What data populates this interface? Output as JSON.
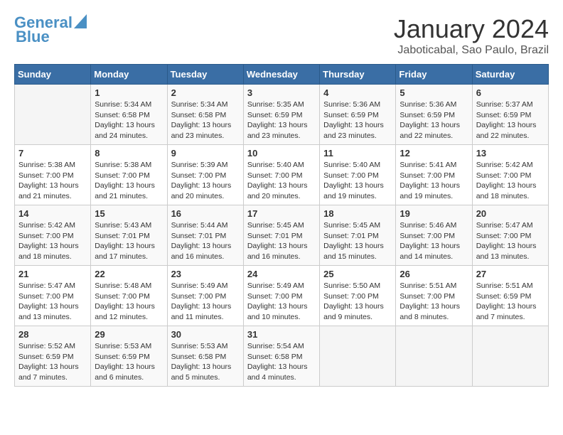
{
  "header": {
    "logo_line1": "General",
    "logo_line2": "Blue",
    "title": "January 2024",
    "subtitle": "Jaboticabal, Sao Paulo, Brazil"
  },
  "days_of_week": [
    "Sunday",
    "Monday",
    "Tuesday",
    "Wednesday",
    "Thursday",
    "Friday",
    "Saturday"
  ],
  "weeks": [
    [
      {
        "day": "",
        "content": ""
      },
      {
        "day": "1",
        "content": "Sunrise: 5:34 AM\nSunset: 6:58 PM\nDaylight: 13 hours\nand 24 minutes."
      },
      {
        "day": "2",
        "content": "Sunrise: 5:34 AM\nSunset: 6:58 PM\nDaylight: 13 hours\nand 23 minutes."
      },
      {
        "day": "3",
        "content": "Sunrise: 5:35 AM\nSunset: 6:59 PM\nDaylight: 13 hours\nand 23 minutes."
      },
      {
        "day": "4",
        "content": "Sunrise: 5:36 AM\nSunset: 6:59 PM\nDaylight: 13 hours\nand 23 minutes."
      },
      {
        "day": "5",
        "content": "Sunrise: 5:36 AM\nSunset: 6:59 PM\nDaylight: 13 hours\nand 22 minutes."
      },
      {
        "day": "6",
        "content": "Sunrise: 5:37 AM\nSunset: 6:59 PM\nDaylight: 13 hours\nand 22 minutes."
      }
    ],
    [
      {
        "day": "7",
        "content": "Sunrise: 5:38 AM\nSunset: 7:00 PM\nDaylight: 13 hours\nand 21 minutes."
      },
      {
        "day": "8",
        "content": "Sunrise: 5:38 AM\nSunset: 7:00 PM\nDaylight: 13 hours\nand 21 minutes."
      },
      {
        "day": "9",
        "content": "Sunrise: 5:39 AM\nSunset: 7:00 PM\nDaylight: 13 hours\nand 20 minutes."
      },
      {
        "day": "10",
        "content": "Sunrise: 5:40 AM\nSunset: 7:00 PM\nDaylight: 13 hours\nand 20 minutes."
      },
      {
        "day": "11",
        "content": "Sunrise: 5:40 AM\nSunset: 7:00 PM\nDaylight: 13 hours\nand 19 minutes."
      },
      {
        "day": "12",
        "content": "Sunrise: 5:41 AM\nSunset: 7:00 PM\nDaylight: 13 hours\nand 19 minutes."
      },
      {
        "day": "13",
        "content": "Sunrise: 5:42 AM\nSunset: 7:00 PM\nDaylight: 13 hours\nand 18 minutes."
      }
    ],
    [
      {
        "day": "14",
        "content": "Sunrise: 5:42 AM\nSunset: 7:00 PM\nDaylight: 13 hours\nand 18 minutes."
      },
      {
        "day": "15",
        "content": "Sunrise: 5:43 AM\nSunset: 7:01 PM\nDaylight: 13 hours\nand 17 minutes."
      },
      {
        "day": "16",
        "content": "Sunrise: 5:44 AM\nSunset: 7:01 PM\nDaylight: 13 hours\nand 16 minutes."
      },
      {
        "day": "17",
        "content": "Sunrise: 5:45 AM\nSunset: 7:01 PM\nDaylight: 13 hours\nand 16 minutes."
      },
      {
        "day": "18",
        "content": "Sunrise: 5:45 AM\nSunset: 7:01 PM\nDaylight: 13 hours\nand 15 minutes."
      },
      {
        "day": "19",
        "content": "Sunrise: 5:46 AM\nSunset: 7:00 PM\nDaylight: 13 hours\nand 14 minutes."
      },
      {
        "day": "20",
        "content": "Sunrise: 5:47 AM\nSunset: 7:00 PM\nDaylight: 13 hours\nand 13 minutes."
      }
    ],
    [
      {
        "day": "21",
        "content": "Sunrise: 5:47 AM\nSunset: 7:00 PM\nDaylight: 13 hours\nand 13 minutes."
      },
      {
        "day": "22",
        "content": "Sunrise: 5:48 AM\nSunset: 7:00 PM\nDaylight: 13 hours\nand 12 minutes."
      },
      {
        "day": "23",
        "content": "Sunrise: 5:49 AM\nSunset: 7:00 PM\nDaylight: 13 hours\nand 11 minutes."
      },
      {
        "day": "24",
        "content": "Sunrise: 5:49 AM\nSunset: 7:00 PM\nDaylight: 13 hours\nand 10 minutes."
      },
      {
        "day": "25",
        "content": "Sunrise: 5:50 AM\nSunset: 7:00 PM\nDaylight: 13 hours\nand 9 minutes."
      },
      {
        "day": "26",
        "content": "Sunrise: 5:51 AM\nSunset: 7:00 PM\nDaylight: 13 hours\nand 8 minutes."
      },
      {
        "day": "27",
        "content": "Sunrise: 5:51 AM\nSunset: 6:59 PM\nDaylight: 13 hours\nand 7 minutes."
      }
    ],
    [
      {
        "day": "28",
        "content": "Sunrise: 5:52 AM\nSunset: 6:59 PM\nDaylight: 13 hours\nand 7 minutes."
      },
      {
        "day": "29",
        "content": "Sunrise: 5:53 AM\nSunset: 6:59 PM\nDaylight: 13 hours\nand 6 minutes."
      },
      {
        "day": "30",
        "content": "Sunrise: 5:53 AM\nSunset: 6:58 PM\nDaylight: 13 hours\nand 5 minutes."
      },
      {
        "day": "31",
        "content": "Sunrise: 5:54 AM\nSunset: 6:58 PM\nDaylight: 13 hours\nand 4 minutes."
      },
      {
        "day": "",
        "content": ""
      },
      {
        "day": "",
        "content": ""
      },
      {
        "day": "",
        "content": ""
      }
    ]
  ]
}
